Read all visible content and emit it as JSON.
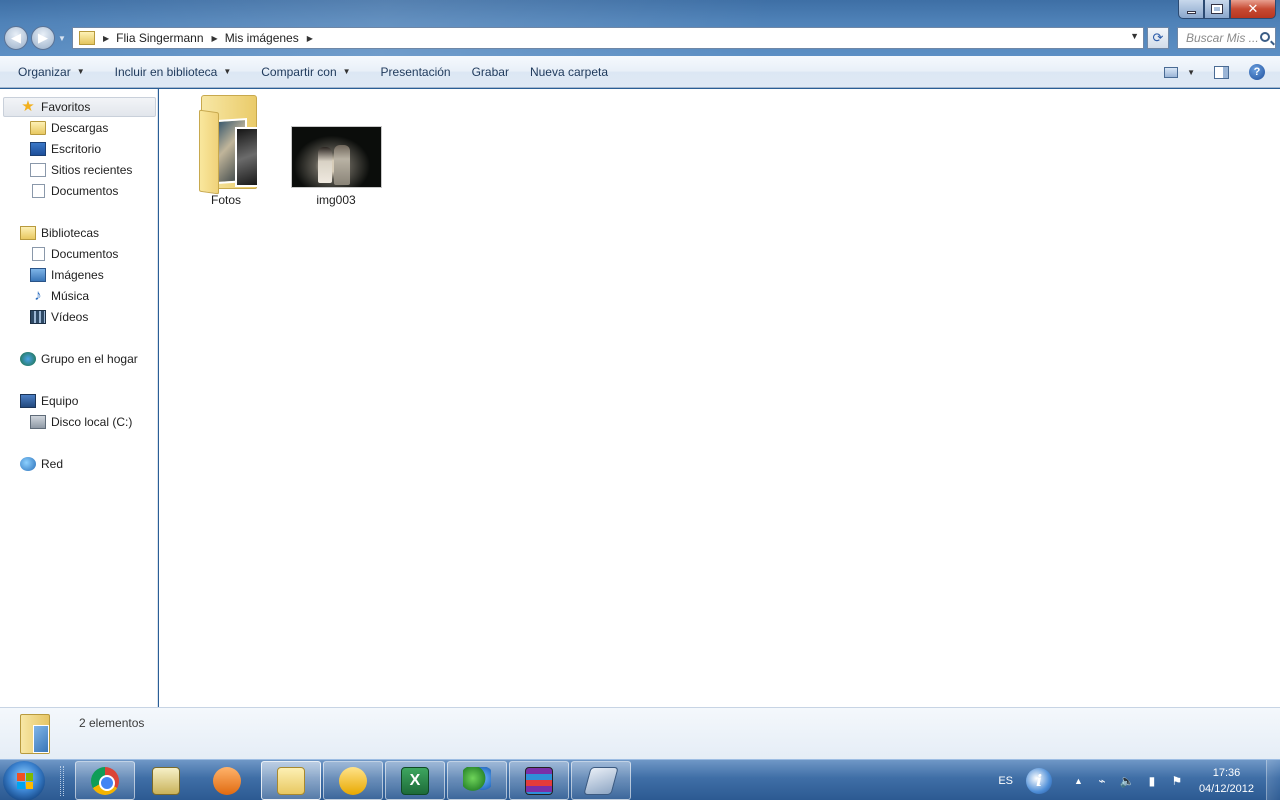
{
  "window": {
    "breadcrumb": [
      "Flia Singermann",
      "Mis imágenes"
    ],
    "search_placeholder": "Buscar Mis ..."
  },
  "toolbar": {
    "organize": "Organizar",
    "include_library": "Incluir en biblioteca",
    "share_with": "Compartir con",
    "slideshow": "Presentación",
    "burn": "Grabar",
    "new_folder": "Nueva carpeta"
  },
  "navpane": {
    "favorites": {
      "label": "Favoritos",
      "items": [
        "Descargas",
        "Escritorio",
        "Sitios recientes",
        "Documentos"
      ]
    },
    "libraries": {
      "label": "Bibliotecas",
      "items": [
        "Documentos",
        "Imágenes",
        "Música",
        "Vídeos"
      ]
    },
    "homegroup": "Grupo en el hogar",
    "computer": {
      "label": "Equipo",
      "items": [
        "Disco local (C:)"
      ]
    },
    "network": "Red"
  },
  "files": [
    {
      "name": "Fotos",
      "type": "folder"
    },
    {
      "name": "img003",
      "type": "image"
    }
  ],
  "details": {
    "count_text": "2 elementos"
  },
  "taskbar": {
    "apps": [
      "chrome",
      "calendar",
      "media-player",
      "explorer",
      "mail",
      "excel",
      "messenger",
      "winrar",
      "scanner"
    ],
    "tray": {
      "lang": "ES",
      "time": "17:36",
      "date": "04/12/2012"
    }
  },
  "colors": {
    "taskbar": "#2c5a92",
    "accent": "#1e395b"
  }
}
